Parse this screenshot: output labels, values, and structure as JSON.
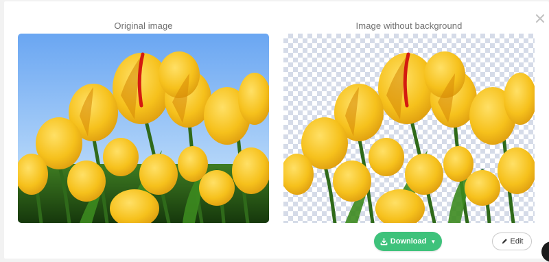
{
  "modal": {
    "close_icon": "close-icon",
    "left_title": "Original image",
    "right_title": "Image without background"
  },
  "actions": {
    "download_label": "Download",
    "download_icon": "download-icon",
    "dropdown_icon": "caret-down-icon",
    "edit_label": "Edit",
    "edit_icon": "pencil-icon"
  },
  "colors": {
    "accent_green": "#3ec27b",
    "sky_top": "#74aef5",
    "sky_bottom": "#c9e2fb",
    "tulip_yellow": "#f5c21a",
    "tulip_shadow": "#d99a0e",
    "stem_green": "#2f6f1c",
    "checker": "#d5dbe8"
  }
}
